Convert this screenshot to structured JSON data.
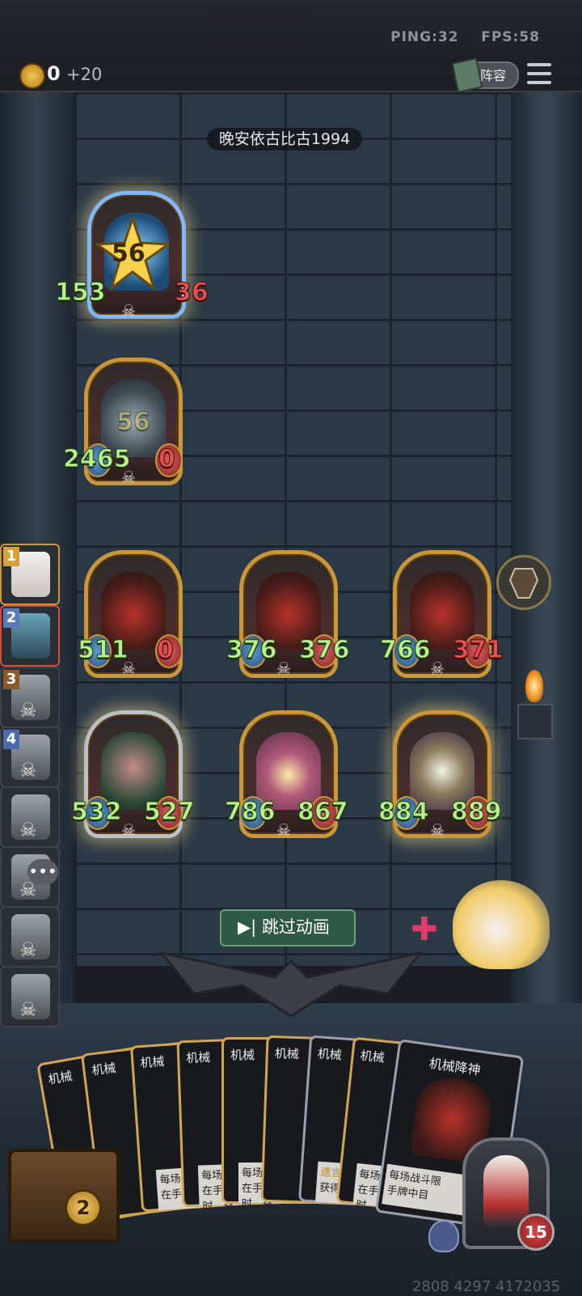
{
  "status": {
    "ping": "PING:32",
    "fps": "FPS:58"
  },
  "resources": {
    "coins": "0",
    "coin_income": "+20"
  },
  "header": {
    "lineup_label": "阵容"
  },
  "opponent": {
    "name": "晚安依古比古1994",
    "level": "56",
    "attack": "153",
    "health": "36"
  },
  "hero": {
    "attack": "2465",
    "health": "0",
    "overlay_level": "56"
  },
  "board": {
    "row1": [
      {
        "attack": "511",
        "health": "0"
      },
      {
        "attack": "376",
        "health": "376"
      },
      {
        "attack": "766",
        "health": "371"
      }
    ],
    "row2": [
      {
        "attack": "532",
        "health": "527"
      },
      {
        "attack": "786",
        "health": "867"
      },
      {
        "attack": "884",
        "health": "889"
      }
    ]
  },
  "sidebar": {
    "ranks": [
      "1",
      "2",
      "3",
      "4"
    ]
  },
  "skip_button": {
    "label": "跳过动画"
  },
  "hand": {
    "cards": [
      {
        "title": "机械"
      },
      {
        "title": "机械"
      },
      {
        "title": "机械"
      },
      {
        "title": "机械"
      },
      {
        "title": "机械"
      },
      {
        "title": "机械"
      },
      {
        "title": "机械"
      },
      {
        "title": "机械"
      },
      {
        "title": "机械降神"
      }
    ],
    "texts": [
      "每场战斗限",
      "在手",
      "时，召",
      "每场",
      "在手",
      "时，召",
      "每场",
      "在手",
      "时，召",
      "遗言",
      "获得",
      "每场",
      "在手",
      "时，召",
      "每场战斗限",
      "手牌中目"
    ]
  },
  "player": {
    "gold": "2",
    "health": "15"
  },
  "footer": {
    "id_text": "2808 4297 4172035"
  },
  "colors": {
    "gold_frame": "#c99739",
    "attack_green": "#b6f08a",
    "damage_red": "#e94d4d",
    "skip_green": "#2e5a45"
  }
}
